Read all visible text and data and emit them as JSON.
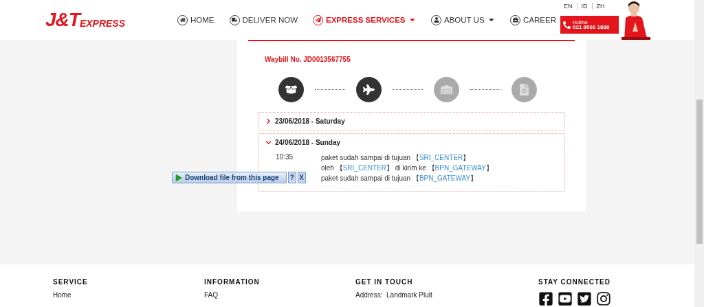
{
  "header": {
    "logo": {
      "main": "J&T",
      "sub": "EXPRESS"
    },
    "nav": [
      {
        "label": "HOME",
        "kind": "home",
        "selected": false,
        "dropdown": false
      },
      {
        "label": "DELIVER NOW",
        "kind": "deliver",
        "selected": false,
        "dropdown": false
      },
      {
        "label": "EXPRESS SERVICES",
        "kind": "express",
        "selected": true,
        "dropdown": true
      },
      {
        "label": "ABOUT US",
        "kind": "about",
        "selected": false,
        "dropdown": true
      },
      {
        "label": "CAREER",
        "kind": "career",
        "selected": false,
        "dropdown": false
      }
    ],
    "languages": [
      "EN",
      "ID",
      "ZH"
    ],
    "hotline": {
      "label": "Hotline",
      "number": "021 8066 1888"
    }
  },
  "tracking": {
    "waybill": "Waybill No. JD0013567755",
    "steps": [
      {
        "kind": "box",
        "done": true
      },
      {
        "kind": "plane",
        "done": true
      },
      {
        "kind": "warehouse",
        "done": false
      },
      {
        "kind": "document",
        "done": false
      }
    ],
    "days": [
      {
        "date": "23/06/2018 - Saturday",
        "expanded": false
      },
      {
        "date": "24/06/2018 - Sunday",
        "expanded": true,
        "events": [
          {
            "time": "10:35",
            "parts": [
              "paket sudah sampai di tujuan 【",
              "SRI_CENTER",
              "】"
            ]
          },
          {
            "parts": [
              "oleh 【",
              "SRI_CENTER",
              "】 di kirim ke 【",
              "BPN_GATEWAY",
              "】"
            ]
          },
          {
            "parts": [
              "paket sudah sampai di tujuan 【",
              "BPN_GATEWAY",
              "】"
            ]
          }
        ]
      }
    ]
  },
  "download_bar": {
    "label": "Download file from this page",
    "help": "?",
    "close": "X"
  },
  "footer": [
    {
      "heading": "SERVICE",
      "items": [
        "Home"
      ]
    },
    {
      "heading": "INFORMATION",
      "items": [
        "FAQ"
      ]
    },
    {
      "heading": "GET IN TOUCH",
      "items": [
        "Address:  Landmark Pluit"
      ]
    },
    {
      "heading": "STAY CONNECTED"
    }
  ]
}
